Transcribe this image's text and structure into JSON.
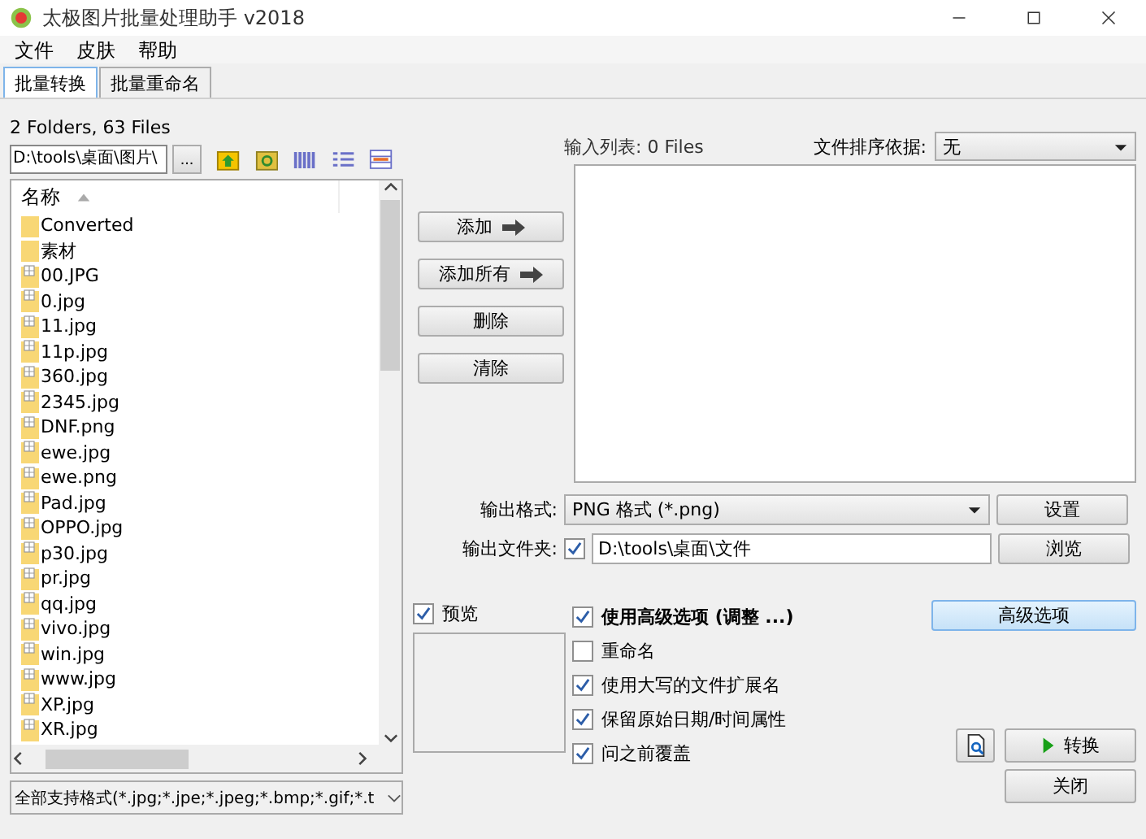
{
  "window": {
    "title": "太极图片批量处理助手  v2018"
  },
  "menu": [
    "文件",
    "皮肤",
    "帮助"
  ],
  "tabs": [
    {
      "label": "批量转换",
      "selected": true
    },
    {
      "label": "批量重命名",
      "selected": false
    }
  ],
  "browser": {
    "summary": "2 Folders, 63 Files",
    "path": "D:\\tools\\桌面\\图片\\",
    "browse_button": "...",
    "column": "名称",
    "items": [
      {
        "kind": "folder",
        "name": "Converted"
      },
      {
        "kind": "folder",
        "name": "素材"
      },
      {
        "kind": "file",
        "name": "00.JPG"
      },
      {
        "kind": "file",
        "name": "0.jpg"
      },
      {
        "kind": "file",
        "name": "11.jpg"
      },
      {
        "kind": "file",
        "name": "11p.jpg"
      },
      {
        "kind": "file",
        "name": "360.jpg"
      },
      {
        "kind": "file",
        "name": "2345.jpg"
      },
      {
        "kind": "file",
        "name": "DNF.png"
      },
      {
        "kind": "file",
        "name": "ewe.jpg"
      },
      {
        "kind": "file",
        "name": "ewe.png"
      },
      {
        "kind": "file",
        "name": "Pad.jpg"
      },
      {
        "kind": "file",
        "name": "OPPO.jpg"
      },
      {
        "kind": "file",
        "name": "p30.jpg"
      },
      {
        "kind": "file",
        "name": "pr.jpg"
      },
      {
        "kind": "file",
        "name": "qq.jpg"
      },
      {
        "kind": "file",
        "name": "vivo.jpg"
      },
      {
        "kind": "file",
        "name": "win.jpg"
      },
      {
        "kind": "file",
        "name": "www.jpg"
      },
      {
        "kind": "file",
        "name": "XP.jpg"
      },
      {
        "kind": "file",
        "name": "XR.jpg"
      }
    ],
    "filter": "全部支持格式(*.jpg;*.jpe;*.jpeg;*.bmp;*.gif;*.t"
  },
  "list_buttons": [
    {
      "label": "添加",
      "arrow": true
    },
    {
      "label": "添加所有",
      "arrow": true
    },
    {
      "label": "删除",
      "arrow": false
    },
    {
      "label": "清除",
      "arrow": false
    }
  ],
  "input_list": {
    "label": "输入列表: 0 Files",
    "sort_label": "文件排序依据:",
    "sort_value": "无"
  },
  "output": {
    "format_label": "输出格式:",
    "format_value": "PNG 格式  (*.png)",
    "settings_button": "设置",
    "folder_label": "输出文件夹:",
    "folder_checked": true,
    "folder_value": "D:\\tools\\桌面\\文件",
    "browse_button": "浏览"
  },
  "preview": {
    "label": "预览",
    "checked": true
  },
  "options": [
    {
      "label": "使用高级选项 (调整 ...)",
      "checked": true,
      "bold": true
    },
    {
      "label": "重命名",
      "checked": false,
      "bold": false
    },
    {
      "label": "使用大写的文件扩展名",
      "checked": true,
      "bold": false
    },
    {
      "label": "保留原始日期/时间属性",
      "checked": true,
      "bold": false
    },
    {
      "label": "问之前覆盖",
      "checked": true,
      "bold": false
    }
  ],
  "advanced_button": "高级选项",
  "convert_button": "转换",
  "close_button": "关闭"
}
